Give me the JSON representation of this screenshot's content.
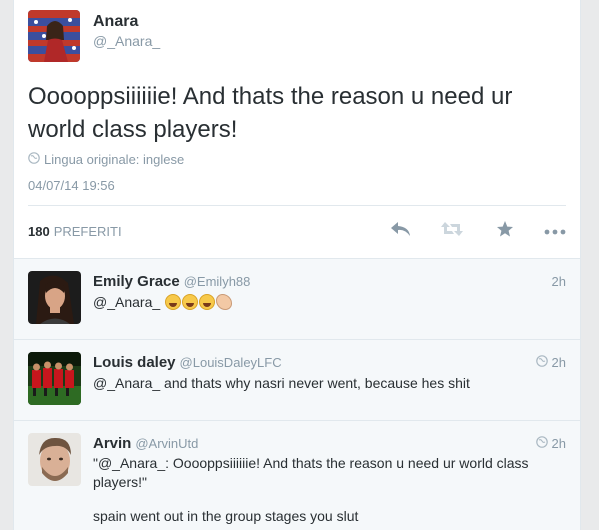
{
  "tweet": {
    "author_name": "Anara",
    "author_handle": "@_Anara_",
    "text": "Ooooppsiiiiiie! And thats the reason u need ur world class players!",
    "language_label": "Lingua originale: inglese",
    "timestamp": "04/07/14 19:56",
    "favorites_count": "180",
    "favorites_label": "PREFERITI",
    "actions": [
      {
        "name": "reply",
        "icon": "reply-icon"
      },
      {
        "name": "retweet",
        "icon": "retweet-icon"
      },
      {
        "name": "favorite",
        "icon": "star-icon"
      },
      {
        "name": "more",
        "icon": "more-icon"
      }
    ]
  },
  "replies": [
    {
      "name": "Emily Grace",
      "handle": "@Emilyh88",
      "time": "2h",
      "text": "@_Anara_",
      "emojis": [
        "tears-of-joy",
        "tears-of-joy",
        "tears-of-joy",
        "clapping-hands"
      ]
    },
    {
      "name": "Louis daley",
      "handle": "@LouisDaleyLFC",
      "time": "2h",
      "text": "@_Anara_ and thats why nasri never went, because hes shit"
    },
    {
      "name": "Arvin",
      "handle": "@ArvinUtd",
      "time": "2h",
      "text_line1": "\"@_Anara_: Ooooppsiiiiiie! And thats the reason u need ur world class players!\"",
      "text_line2": "spain went out in the group stages you slut"
    }
  ],
  "colors": {
    "text": "#292f33",
    "muted": "#8899a6",
    "border": "#e1e8ed",
    "reply_bg": "#f5f8fa"
  }
}
